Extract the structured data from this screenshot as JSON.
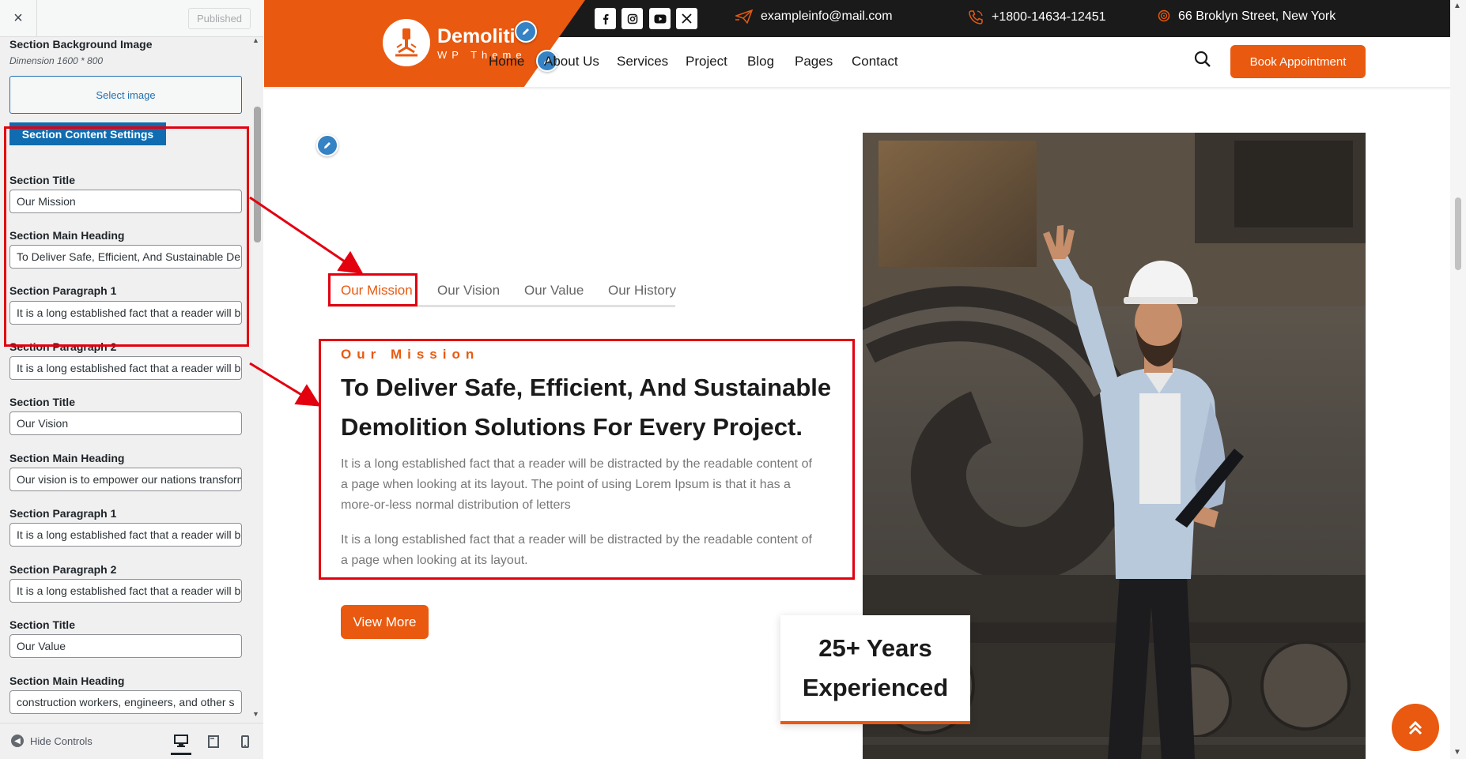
{
  "sidebar": {
    "close_icon": "×",
    "published_label": "Published",
    "bg_image_label": "Section Background Image",
    "bg_image_note": "Dimension 1600 * 800",
    "select_image_label": "Select image",
    "content_settings_label": "Section Content Settings",
    "fields": [
      {
        "label": "Section Title",
        "value": "Our Mission"
      },
      {
        "label": "Section Main Heading",
        "value": "To Deliver Safe, Efficient, And Sustainable Demolition Solutions For Every Project."
      },
      {
        "label": "Section Paragraph 1",
        "value": "It is a long established fact that a reader will be distracted by the readable content"
      },
      {
        "label": "Section Paragraph 2",
        "value": "It is a long established fact that a reader will be distracted by the readable content"
      },
      {
        "label": "Section Title",
        "value": "Our Vision"
      },
      {
        "label": "Section Main Heading",
        "value": "Our vision is to empower our nations transformation"
      },
      {
        "label": "Section Paragraph 1",
        "value": "It is a long established fact that a reader will be distracted by the readable content"
      },
      {
        "label": "Section Paragraph 2",
        "value": "It is a long established fact that a reader will be distracted by the readable content"
      },
      {
        "label": "Section Title",
        "value": "Our Value"
      },
      {
        "label": "Section Main Heading",
        "value": "construction workers, engineers, and other s"
      }
    ],
    "hide_controls_label": "Hide Controls",
    "devices": [
      "desktop-icon",
      "tablet-icon",
      "mobile-icon"
    ]
  },
  "header": {
    "logo_title": "Demoliti",
    "logo_subtitle": "WP Theme",
    "socials": [
      "facebook-icon",
      "instagram-icon",
      "youtube-icon",
      "x-icon"
    ],
    "email": "exampleinfo@mail.com",
    "phone": "+1800-14634-12451",
    "address": "66 Broklyn Street, New York",
    "nav": [
      "Home",
      "About Us",
      "Services",
      "Project",
      "Blog",
      "Pages",
      "Contact"
    ],
    "book_label": "Book Appointment"
  },
  "main": {
    "tabs": [
      "Our Mission",
      "Our Vision",
      "Our Value",
      "Our History"
    ],
    "active_tab": "Our Mission",
    "eyebrow": "Our Mission",
    "heading": "To Deliver Safe, Efficient, And Sustainable Demolition Solutions For Every Project.",
    "paragraph1": "It is a long established fact that a reader will be distracted by the readable content of a page when looking at its layout. The point of using Lorem Ipsum is that it has a more-or-less normal distribution of letters",
    "paragraph2": "It is a long established fact that a reader will be distracted by the readable content of a page when looking at its layout.",
    "view_more_label": "View More",
    "years_text": "25+ Years Experienced"
  },
  "colors": {
    "accent": "#e9590f",
    "topbar": "#1a1a1a",
    "annotation": "#e3000f",
    "wp_blue": "#2271b1"
  }
}
